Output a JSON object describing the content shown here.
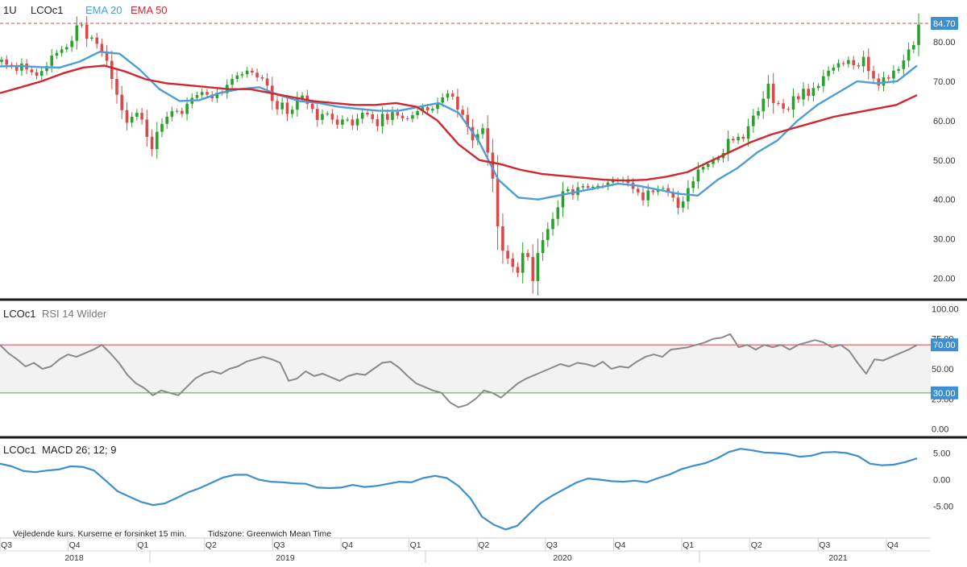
{
  "header": {
    "period": "1U",
    "symbol": "LCOc1"
  },
  "legend": {
    "ema20": "EMA 20",
    "ema50": "EMA 50"
  },
  "rsi": {
    "symbol": "LCOc1",
    "label": "RSI 14 Wilder"
  },
  "macd": {
    "symbol": "LCOc1",
    "label": "MACD 26; 12; 9"
  },
  "footer": {
    "note": "Vejledende kurs. Kurserne er forsinket 15 min.",
    "timezone": "Tidszone: Greenwich Mean Time"
  },
  "colors": {
    "up": "#2ca02c",
    "down": "#d94a4a",
    "ema20": "#4c9fd6",
    "ema50": "#d1262e",
    "rsi": "#8a8a8a",
    "macd": "#3b8fcf",
    "upper": "#d94040",
    "lower": "#3fae3f",
    "band": "#f2f2f2",
    "price_badge": "#3d8fd1",
    "divider": "#1a1a1a",
    "axis_text": "#333333"
  },
  "chart_data": [
    {
      "type": "candlestick",
      "title": "LCOc1",
      "interval": "1U",
      "ylim": [
        15,
        89
      ],
      "yticks": [
        "20.00",
        "30.00",
        "40.00",
        "50.00",
        "60.00",
        "70.00",
        "80.00"
      ],
      "last_price": "84.70",
      "last_price_value": 84.7,
      "quarter_labels": [
        "Q3",
        "Q4",
        "Q1",
        "Q2",
        "Q3",
        "Q4",
        "Q1",
        "Q2",
        "Q3",
        "Q4",
        "Q1",
        "Q2",
        "Q3",
        "Q4"
      ],
      "year_labels": [
        "2018",
        "2019",
        "2020",
        "2021"
      ],
      "ohlc_weekly_anchors": {
        "description": "approximate weekly close path read from chart (index = week from 2018-07-02)",
        "closes": [
          75.5,
          74.2,
          73.8,
          72.7,
          74.5,
          73.0,
          72.3,
          71.4,
          72.6,
          73.9,
          76.5,
          77.2,
          78.1,
          78.7,
          80.3,
          84.2,
          84.4,
          80.8,
          81.1,
          79.5,
          77.6,
          75.2,
          70.6,
          66.6,
          62.7,
          59.5,
          61.0,
          62.0,
          60.3,
          55.9,
          52.8,
          57.2,
          59.2,
          61.0,
          62.4,
          62.5,
          61.7,
          64.3,
          65.8,
          66.5,
          67.3,
          66.6,
          65.7,
          67.1,
          67.0,
          69.1,
          70.6,
          71.5,
          71.8,
          72.7,
          72.2,
          71.0,
          70.7,
          68.9,
          65.0,
          62.9,
          64.6,
          61.7,
          62.8,
          65.6,
          66.4,
          64.3,
          63.0,
          60.2,
          61.7,
          61.8,
          60.3,
          59.0,
          60.3,
          60.3,
          58.8,
          60.5,
          62.0,
          61.6,
          60.4,
          58.6,
          61.7,
          60.2,
          62.2,
          61.3,
          60.6,
          60.5,
          61.4,
          62.4,
          63.4,
          62.6,
          63.0,
          64.6,
          65.9,
          66.9,
          66.1,
          62.8,
          61.5,
          58.4,
          55.0,
          56.6,
          58.1,
          51.9,
          45.3,
          33.2,
          27.0,
          25.0,
          22.9,
          21.4,
          26.4,
          25.4,
          19.3,
          26.4,
          29.7,
          32.5,
          35.1,
          38.0,
          42.1,
          42.6,
          41.1,
          43.1,
          43.4,
          43.0,
          43.2,
          43.5,
          43.3,
          44.3,
          45.0,
          44.8,
          45.1,
          44.2,
          42.7,
          41.8,
          39.8,
          42.3,
          41.9,
          42.7,
          42.9,
          41.8,
          40.5,
          37.9,
          39.5,
          42.9,
          44.6,
          47.6,
          48.3,
          49.0,
          50.0,
          50.5,
          51.8,
          55.4,
          55.0,
          55.9,
          55.4,
          58.6,
          61.3,
          62.4,
          65.6,
          69.4,
          64.5,
          64.4,
          63.0,
          62.8,
          66.2,
          65.4,
          68.1,
          66.3,
          68.3,
          68.8,
          71.3,
          72.7,
          73.5,
          74.6,
          74.4,
          75.4,
          74.1,
          73.8,
          76.2,
          72.6,
          70.7,
          68.9,
          71.0,
          70.7,
          72.7,
          73.1,
          75.3,
          78.1,
          79.2,
          84.4
        ]
      },
      "series": [
        {
          "name": "EMA 20",
          "values": [
            73.8,
            73.9,
            73.6,
            73.5,
            75.0,
            77.5,
            77.0,
            73.0,
            68.0,
            65.0,
            65.2,
            67.0,
            68.0,
            68.5,
            66.5,
            65.0,
            64.5,
            63.5,
            63.0,
            62.5,
            62.5,
            63.5,
            64.5,
            62.0,
            55.0,
            45.0,
            40.5,
            40.0,
            41.0,
            42.0,
            43.0,
            44.0,
            43.5,
            42.5,
            41.5,
            41.0,
            45.0,
            48.0,
            52.0,
            55.0,
            60.0,
            64.0,
            67.0,
            70.0,
            69.5,
            70.0,
            74.0
          ]
        },
        {
          "name": "EMA 50",
          "values": [
            67.0,
            68.5,
            70.0,
            72.0,
            73.5,
            74.0,
            72.5,
            70.5,
            69.5,
            69.0,
            68.5,
            68.0,
            68.0,
            67.0,
            66.0,
            65.0,
            64.5,
            64.0,
            64.0,
            64.5,
            63.5,
            60.0,
            54.0,
            50.0,
            49.0,
            47.5,
            46.5,
            46.0,
            45.5,
            45.0,
            44.8,
            45.0,
            45.8,
            47.0,
            49.5,
            52.0,
            54.5,
            56.5,
            58.0,
            59.5,
            61.0,
            62.0,
            63.0,
            64.0,
            66.5
          ]
        }
      ]
    },
    {
      "type": "line",
      "title": "LCOc1 RSI 14 Wilder",
      "ylim": [
        -5,
        105
      ],
      "yticks": [
        "0.00",
        "25.00",
        "50.00",
        "75.00",
        "100.00"
      ],
      "upper_level": "70.00",
      "lower_level": "30.00",
      "series": [
        {
          "name": "RSI 14 Wilder",
          "values": [
            70,
            63,
            58,
            52,
            55,
            50,
            52,
            58,
            62,
            60,
            63,
            66,
            70,
            63,
            55,
            45,
            38,
            34,
            28,
            32,
            30,
            28,
            35,
            42,
            46,
            48,
            46,
            50,
            52,
            56,
            58,
            60,
            58,
            55,
            40,
            42,
            48,
            44,
            46,
            43,
            40,
            44,
            46,
            45,
            50,
            55,
            56,
            51,
            44,
            38,
            35,
            32,
            30,
            22,
            18,
            20,
            25,
            32,
            30,
            26,
            32,
            38,
            42,
            45,
            48,
            51,
            54,
            52,
            55,
            54,
            52,
            56,
            50,
            52,
            51,
            56,
            60,
            62,
            60,
            66,
            67,
            68,
            70,
            72,
            75,
            76,
            79,
            68,
            70,
            66,
            70,
            68,
            70,
            66,
            70,
            72,
            74,
            72,
            68,
            70,
            65,
            55,
            46,
            58,
            57,
            60,
            63,
            66,
            70
          ]
        }
      ]
    },
    {
      "type": "line",
      "title": "LCOc1 MACD 26; 12; 9",
      "ylim": [
        -11,
        7.5
      ],
      "yticks": [
        "-5.00",
        "0.00",
        "5.00"
      ],
      "series": [
        {
          "name": "MACD 26; 12; 9",
          "values": [
            3.0,
            2.5,
            1.6,
            1.4,
            1.7,
            1.9,
            2.5,
            2.4,
            1.7,
            -0.2,
            -2.2,
            -3.2,
            -4.2,
            -4.8,
            -4.5,
            -3.5,
            -2.4,
            -1.6,
            -0.6,
            0.4,
            0.9,
            0.9,
            0.0,
            -0.4,
            -0.5,
            -0.7,
            -0.8,
            -1.5,
            -1.6,
            -1.5,
            -1.0,
            -1.4,
            -1.2,
            -0.8,
            -0.4,
            -0.5,
            0.3,
            0.7,
            0.3,
            -1.2,
            -3.5,
            -7.0,
            -8.5,
            -9.4,
            -8.7,
            -6.5,
            -4.4,
            -3.0,
            -1.8,
            -0.6,
            0.2,
            0.0,
            -0.3,
            -0.4,
            -0.2,
            -0.5,
            0.3,
            1.0,
            2.0,
            2.6,
            3.1,
            4.0,
            5.2,
            5.8,
            5.5,
            5.1,
            5.0,
            4.8,
            4.3,
            4.5,
            5.1,
            5.2,
            5.0,
            4.4,
            3.0,
            2.7,
            2.8,
            3.3,
            4.0
          ]
        }
      ]
    }
  ]
}
